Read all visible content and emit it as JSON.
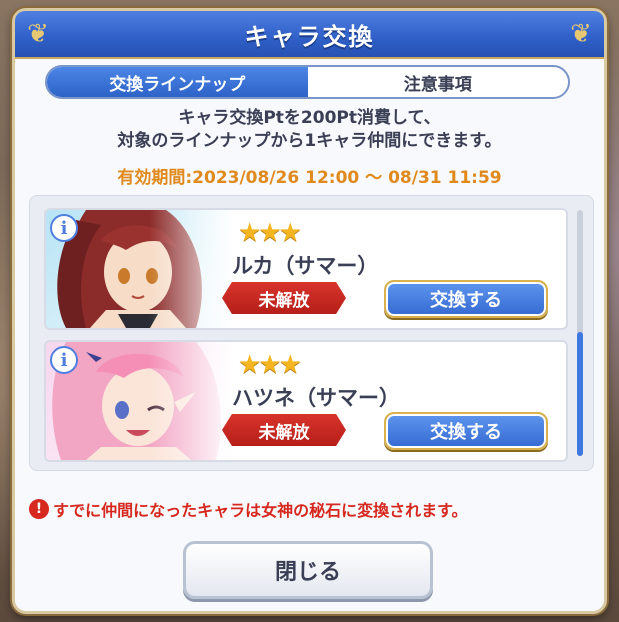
{
  "dialog": {
    "title": "キャラ交換",
    "tabs": [
      {
        "label": "交換ラインナップ",
        "active": true
      },
      {
        "label": "注意事項",
        "active": false
      }
    ],
    "description_line1": "キャラ交換Ptを200Pt消費して、",
    "description_line2": "対象のラインナップから1キャラ仲間にできます。",
    "period": "有効期間:2023/08/26 12:00 〜 08/31 11:59",
    "characters": [
      {
        "name": "ルカ（サマー）",
        "stars": "★★★",
        "rarity": 3,
        "status": "未解放",
        "exchange_label": "交換する",
        "info_label": "i"
      },
      {
        "name": "ハツネ（サマー）",
        "stars": "★★★",
        "rarity": 3,
        "status": "未解放",
        "exchange_label": "交換する",
        "info_label": "i"
      }
    ],
    "warning_icon": "!",
    "warning": "すでに仲間になったキャラは女神の秘石に変換されます。",
    "close_label": "閉じる"
  },
  "colors": {
    "title_blue": "#2f5fc7",
    "accent_orange": "#e08a1e",
    "badge_red": "#c92a22",
    "warning_red": "#d6281f",
    "star_gold": "#f5b521"
  }
}
